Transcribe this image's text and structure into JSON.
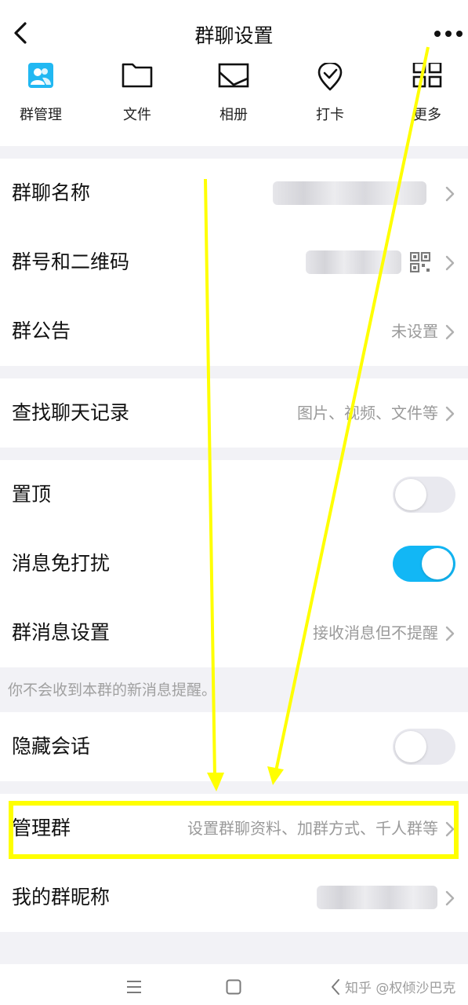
{
  "header": {
    "title": "群聊设置"
  },
  "quick_actions": [
    {
      "label": "群管理",
      "icon": "group-manage-icon"
    },
    {
      "label": "文件",
      "icon": "folder-icon"
    },
    {
      "label": "相册",
      "icon": "album-icon"
    },
    {
      "label": "打卡",
      "icon": "checkin-icon"
    },
    {
      "label": "更多",
      "icon": "grid-icon"
    }
  ],
  "info": {
    "group_name_label": "群聊名称",
    "group_number_label": "群号和二维码",
    "announcement_label": "群公告",
    "announcement_value": "未设置"
  },
  "search": {
    "label": "查找聊天记录",
    "value": "图片、视频、文件等"
  },
  "settings": {
    "pin_label": "置顶",
    "pin_on": false,
    "mute_label": "消息免打扰",
    "mute_on": true,
    "msg_setting_label": "群消息设置",
    "msg_setting_value": "接收消息但不提醒"
  },
  "hint": "你不会收到本群的新消息提醒。",
  "hide_chat": {
    "label": "隐藏会话",
    "on": false
  },
  "manage": {
    "label": "管理群",
    "value": "设置群聊资料、加群方式、千人群等"
  },
  "nickname": {
    "label": "我的群昵称"
  },
  "watermark": "知乎 @权倾沙巴克",
  "colors": {
    "accent": "#12b7f5",
    "annotation": "#ffff00",
    "background": "#f2f2f6"
  }
}
